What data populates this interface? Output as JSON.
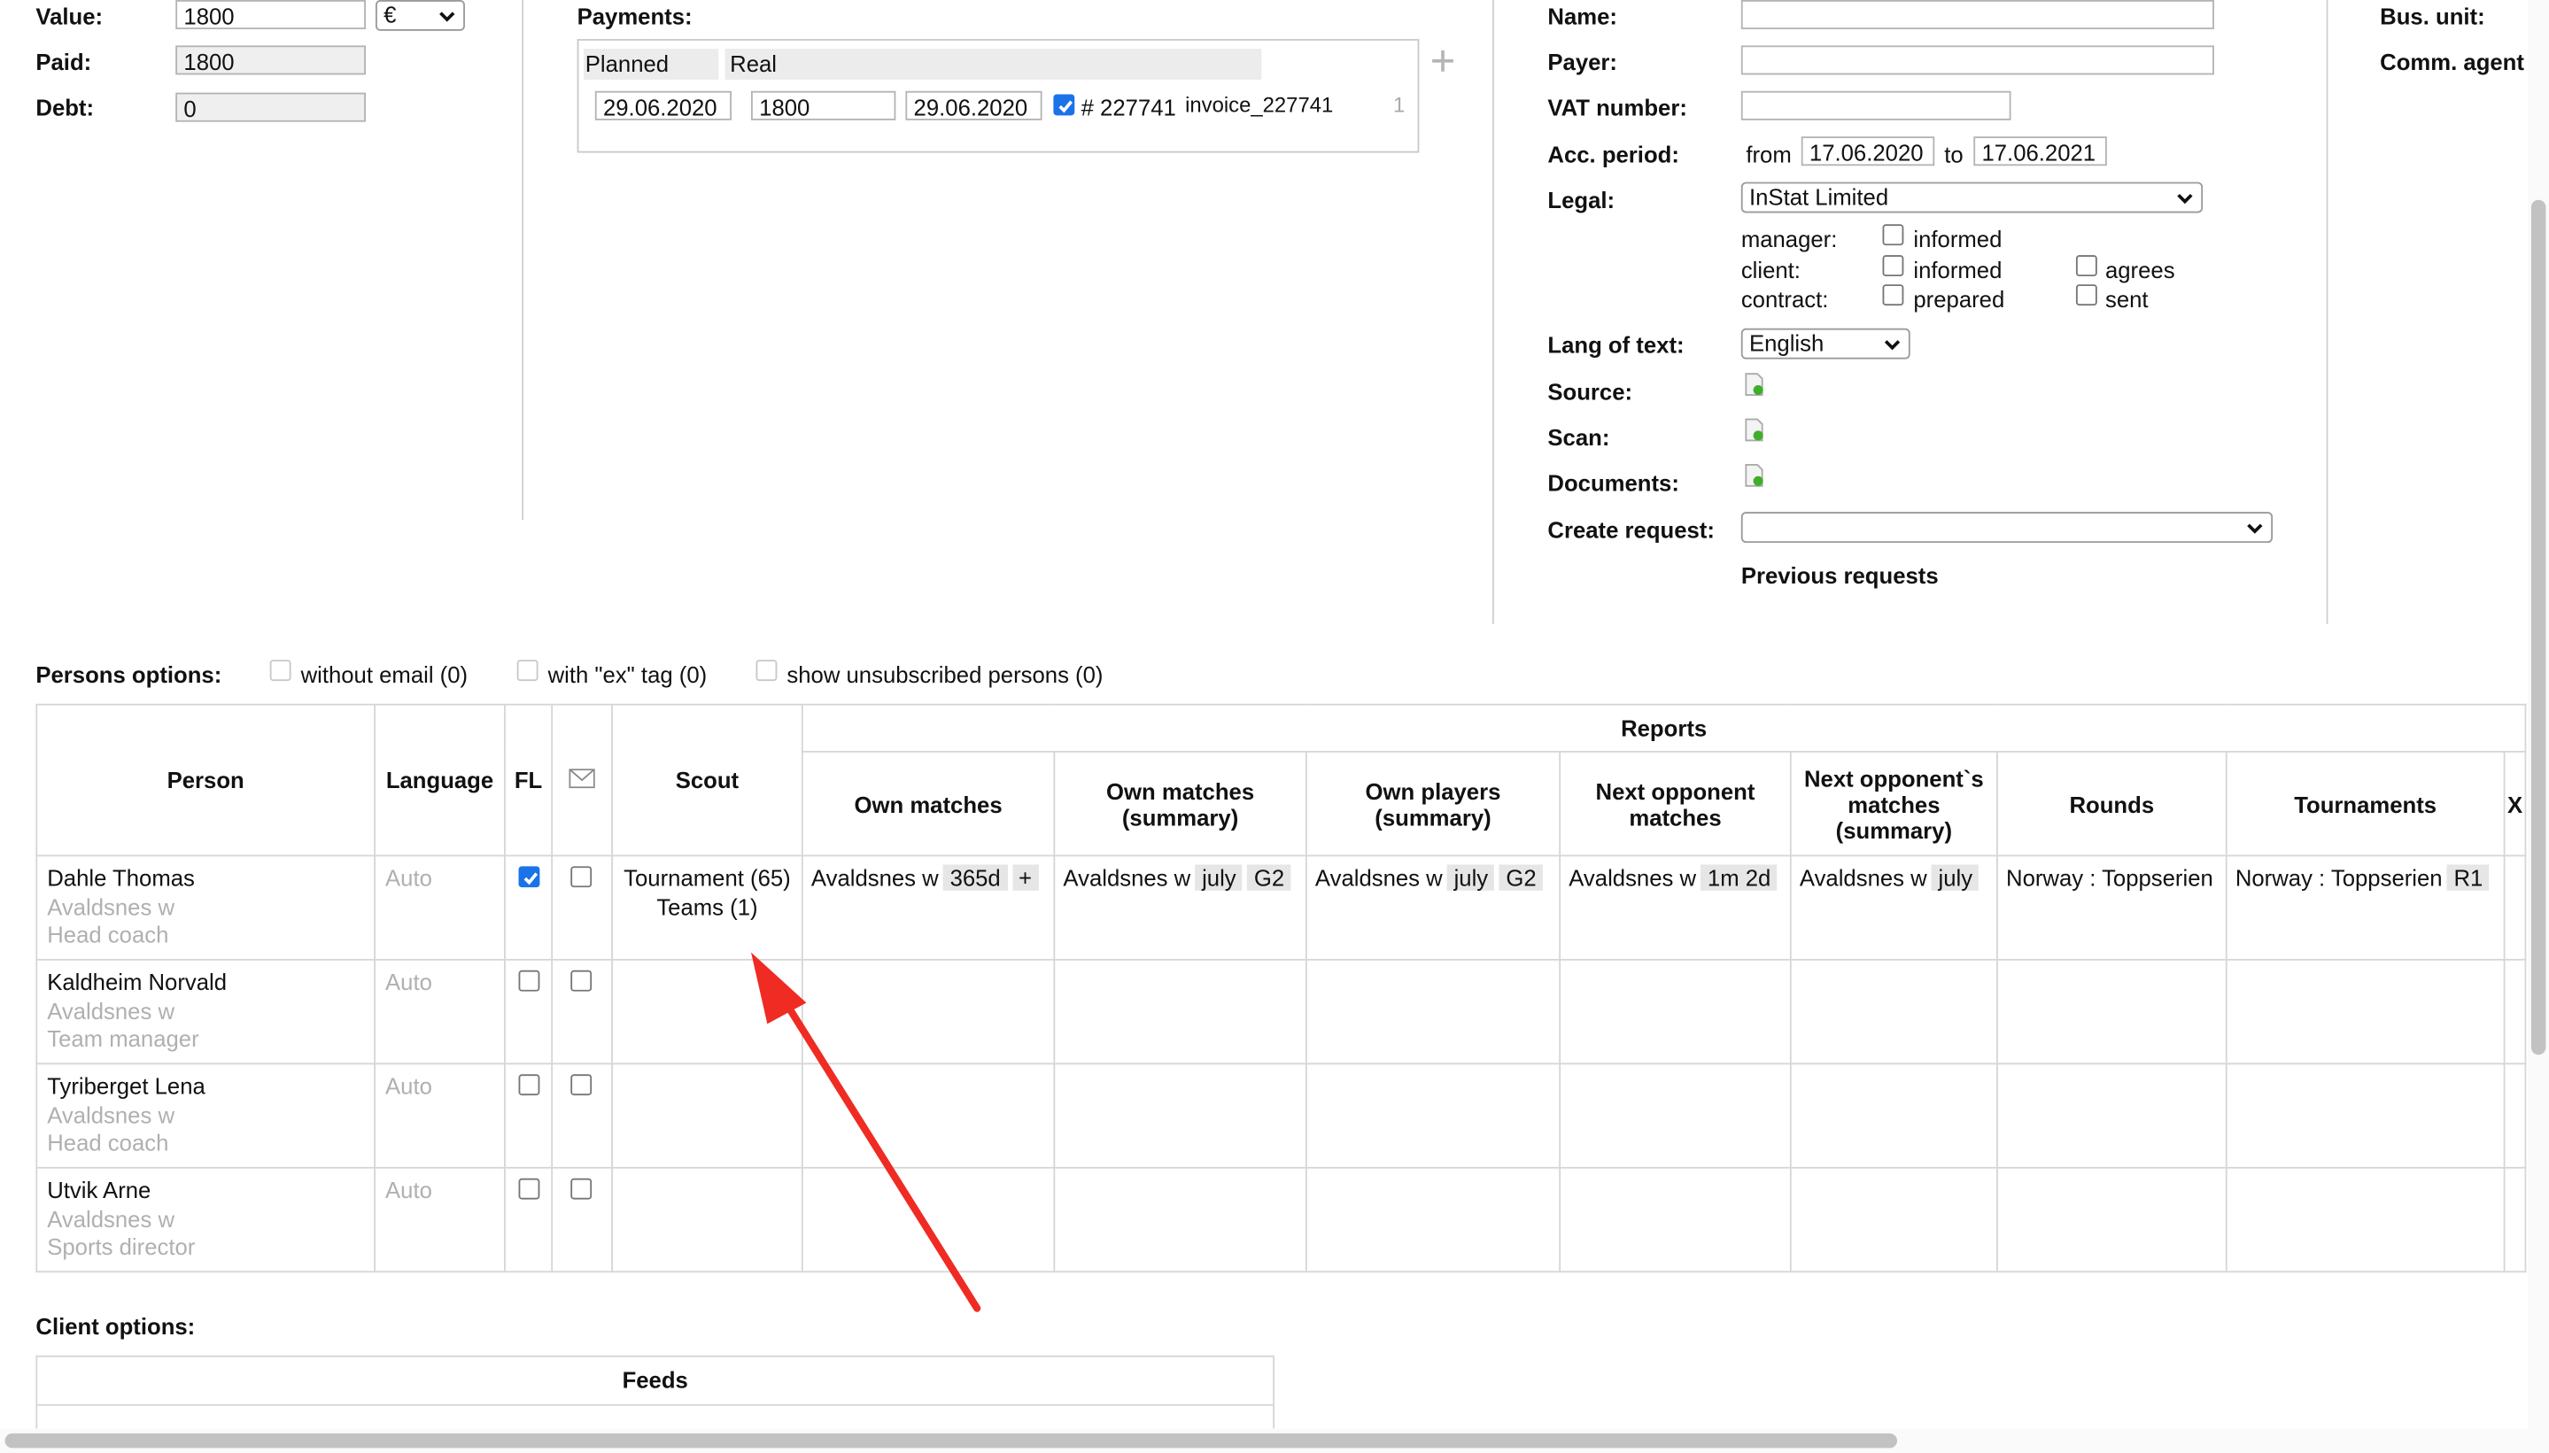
{
  "left_form": {
    "value_label": "Value:",
    "value": "1800",
    "currency": "€",
    "paid_label": "Paid:",
    "paid": "1800",
    "debt_label": "Debt:",
    "debt": "0"
  },
  "payments": {
    "label": "Payments:",
    "planned_header": "Planned",
    "real_header": "Real",
    "row": {
      "planned_date": "29.06.2020",
      "amount": "1800",
      "real_date": "29.06.2020",
      "invoice_number": "# 227741",
      "invoice_name": "invoice_227741",
      "count": "1",
      "checked": true
    },
    "add_icon": "plus-icon"
  },
  "right_form": {
    "name_label": "Name:",
    "name": "",
    "payer_label": "Payer:",
    "payer": "",
    "vat_label": "VAT number:",
    "vat": "",
    "acc_label": "Acc. period:",
    "from_label": "from",
    "from": "17.06.2020",
    "to_label": "to",
    "to": "17.06.2021",
    "legal_label": "Legal:",
    "legal": "InStat Limited",
    "manager_label": "manager:",
    "client_label": "client:",
    "contract_label": "contract:",
    "informed": "informed",
    "informed2": "informed",
    "prepared": "prepared",
    "agrees": "agrees",
    "sent": "sent",
    "lang_label": "Lang of text:",
    "lang": "English",
    "source_label": "Source:",
    "scan_label": "Scan:",
    "documents_label": "Documents:",
    "request_label": "Create request:",
    "request": "",
    "previous_requests": "Previous requests"
  },
  "far_right": {
    "bus_unit_label": "Bus. unit:",
    "comm_agent_label": "Comm. agent"
  },
  "persons_options": {
    "label": "Persons options:",
    "without_email": "without email (0)",
    "with_ex": "with \"ex\" tag (0)",
    "unsubscribed": "show unsubscribed persons (0)"
  },
  "table": {
    "headers": {
      "person": "Person",
      "language": "Language",
      "fl": "FL",
      "scout": "Scout",
      "reports": "Reports",
      "own_matches": "Own matches",
      "own_matches_summary": "Own matches (summary)",
      "own_players_summary": "Own players (summary)",
      "next_opponent_matches": "Next opponent matches",
      "next_opponent_summary": "Next opponent`s matches (summary)",
      "rounds": "Rounds",
      "tournaments": "Tournaments",
      "x": "X"
    },
    "rows": [
      {
        "name": "Dahle Thomas",
        "team": "Avaldsnes w",
        "role": "Head coach",
        "language": "Auto",
        "fl": true,
        "mail": false,
        "scout1": "Tournament (65)",
        "scout2": "Teams (1)",
        "own_matches": "Avaldsnes w",
        "own_matches_tag": "365d",
        "own_matches_tag2": "+",
        "own_matches_sum": "Avaldsnes w",
        "own_matches_sum_tag": "july",
        "own_matches_sum_tag2": "G2",
        "own_players": "Avaldsnes w",
        "own_players_tag": "july",
        "own_players_tag2": "G2",
        "next_opp": "Avaldsnes w",
        "next_opp_tag": "1m 2d",
        "next_opp_sum": "Avaldsnes w",
        "next_opp_sum_tag": "july",
        "rounds": "Norway : Toppserien",
        "tournaments": "Norway : Toppserien",
        "tournaments_tag": "R1"
      },
      {
        "name": "Kaldheim Norvald",
        "team": "Avaldsnes w",
        "role": "Team manager",
        "language": "Auto",
        "fl": false,
        "mail": false
      },
      {
        "name": "Tyriberget Lena",
        "team": "Avaldsnes w",
        "role": "Head coach",
        "language": "Auto",
        "fl": false,
        "mail": false
      },
      {
        "name": "Utvik Arne",
        "team": "Avaldsnes w",
        "role": "Sports director",
        "language": "Auto",
        "fl": false,
        "mail": false
      }
    ]
  },
  "client_options": {
    "label": "Client options:",
    "feeds_header": "Feeds"
  },
  "colors": {
    "accent": "#1a73e8",
    "arrow": "#ef2b23",
    "muted": "#b0b0b0"
  }
}
